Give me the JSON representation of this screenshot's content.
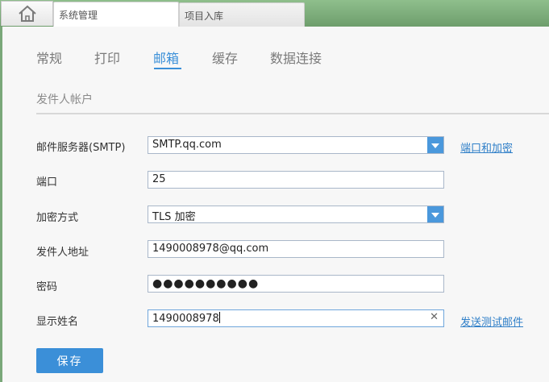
{
  "tabs": [
    {
      "label": "系统管理"
    },
    {
      "label": "项目入库"
    }
  ],
  "settings": {
    "subtabs": [
      {
        "label": "常规"
      },
      {
        "label": "打印"
      },
      {
        "label": "邮箱"
      },
      {
        "label": "缓存"
      },
      {
        "label": "数据连接"
      }
    ],
    "section_title": "发件人帐户",
    "smtp_label": "邮件服务器(SMTP)",
    "smtp_value": "SMTP.qq.com",
    "port_label": "端口",
    "port_value": "25",
    "encryption_label": "加密方式",
    "encryption_value": "TLS 加密",
    "sender_label": "发件人地址",
    "sender_value": "1490008978@qq.com",
    "password_label": "密码",
    "password_value": "●●●●●●●●●●",
    "display_name_label": "显示姓名",
    "display_name_value": "1490008978",
    "port_encryption_link": "端口和加密",
    "send_test_link": "发送测试邮件",
    "save_label": "保存"
  },
  "colors": {
    "accent": "#3a8fd8",
    "tab_background": "#7aa879"
  }
}
